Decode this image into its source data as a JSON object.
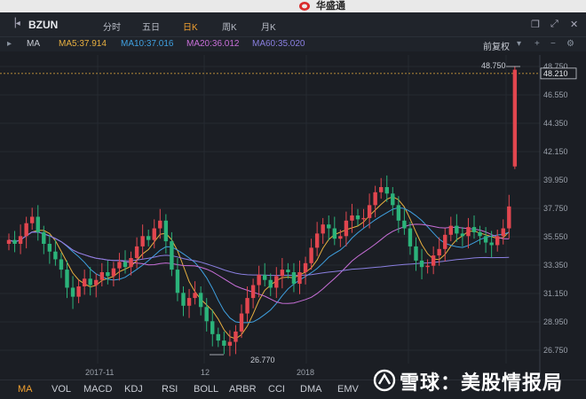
{
  "app": {
    "title": "华盛通"
  },
  "toolbar": {
    "symbol": "BZUN",
    "tabs": [
      {
        "label": "分时",
        "active": false
      },
      {
        "label": "五日",
        "active": false
      },
      {
        "label": "日K",
        "active": true
      },
      {
        "label": "周K",
        "active": false
      },
      {
        "label": "月K",
        "active": false
      }
    ],
    "window_icons": [
      "restore-icon",
      "fullscreen-icon",
      "close-icon"
    ]
  },
  "indicator_bar": {
    "name": "MA",
    "ma5": "MA5:37.914",
    "ma10": "MA10:37.016",
    "ma20": "MA20:36.012",
    "ma60": "MA60:35.020",
    "adjust": "前复权",
    "colors": {
      "ma5": "#e8b040",
      "ma10": "#3fa0e0",
      "ma20": "#c86fd8",
      "ma60": "#8a7fe0",
      "up": "#e2464f",
      "down": "#2bb37a"
    }
  },
  "price_axis": {
    "ticks": [
      "48.750",
      "46.550",
      "44.350",
      "42.150",
      "39.950",
      "37.750",
      "35.550",
      "33.350",
      "31.150",
      "28.950",
      "26.750"
    ],
    "current_price": "48.210",
    "high_label": "48.750",
    "low_label": "26.770"
  },
  "x_axis": {
    "labels": [
      "2017-11",
      "12",
      "2018"
    ]
  },
  "bottom_tabs": [
    "MA",
    "VOL",
    "MACD",
    "KDJ",
    "RSI",
    "BOLL",
    "ARBR",
    "CCI",
    "DMA",
    "EMV"
  ],
  "watermark": "雪球：美股情报局"
}
